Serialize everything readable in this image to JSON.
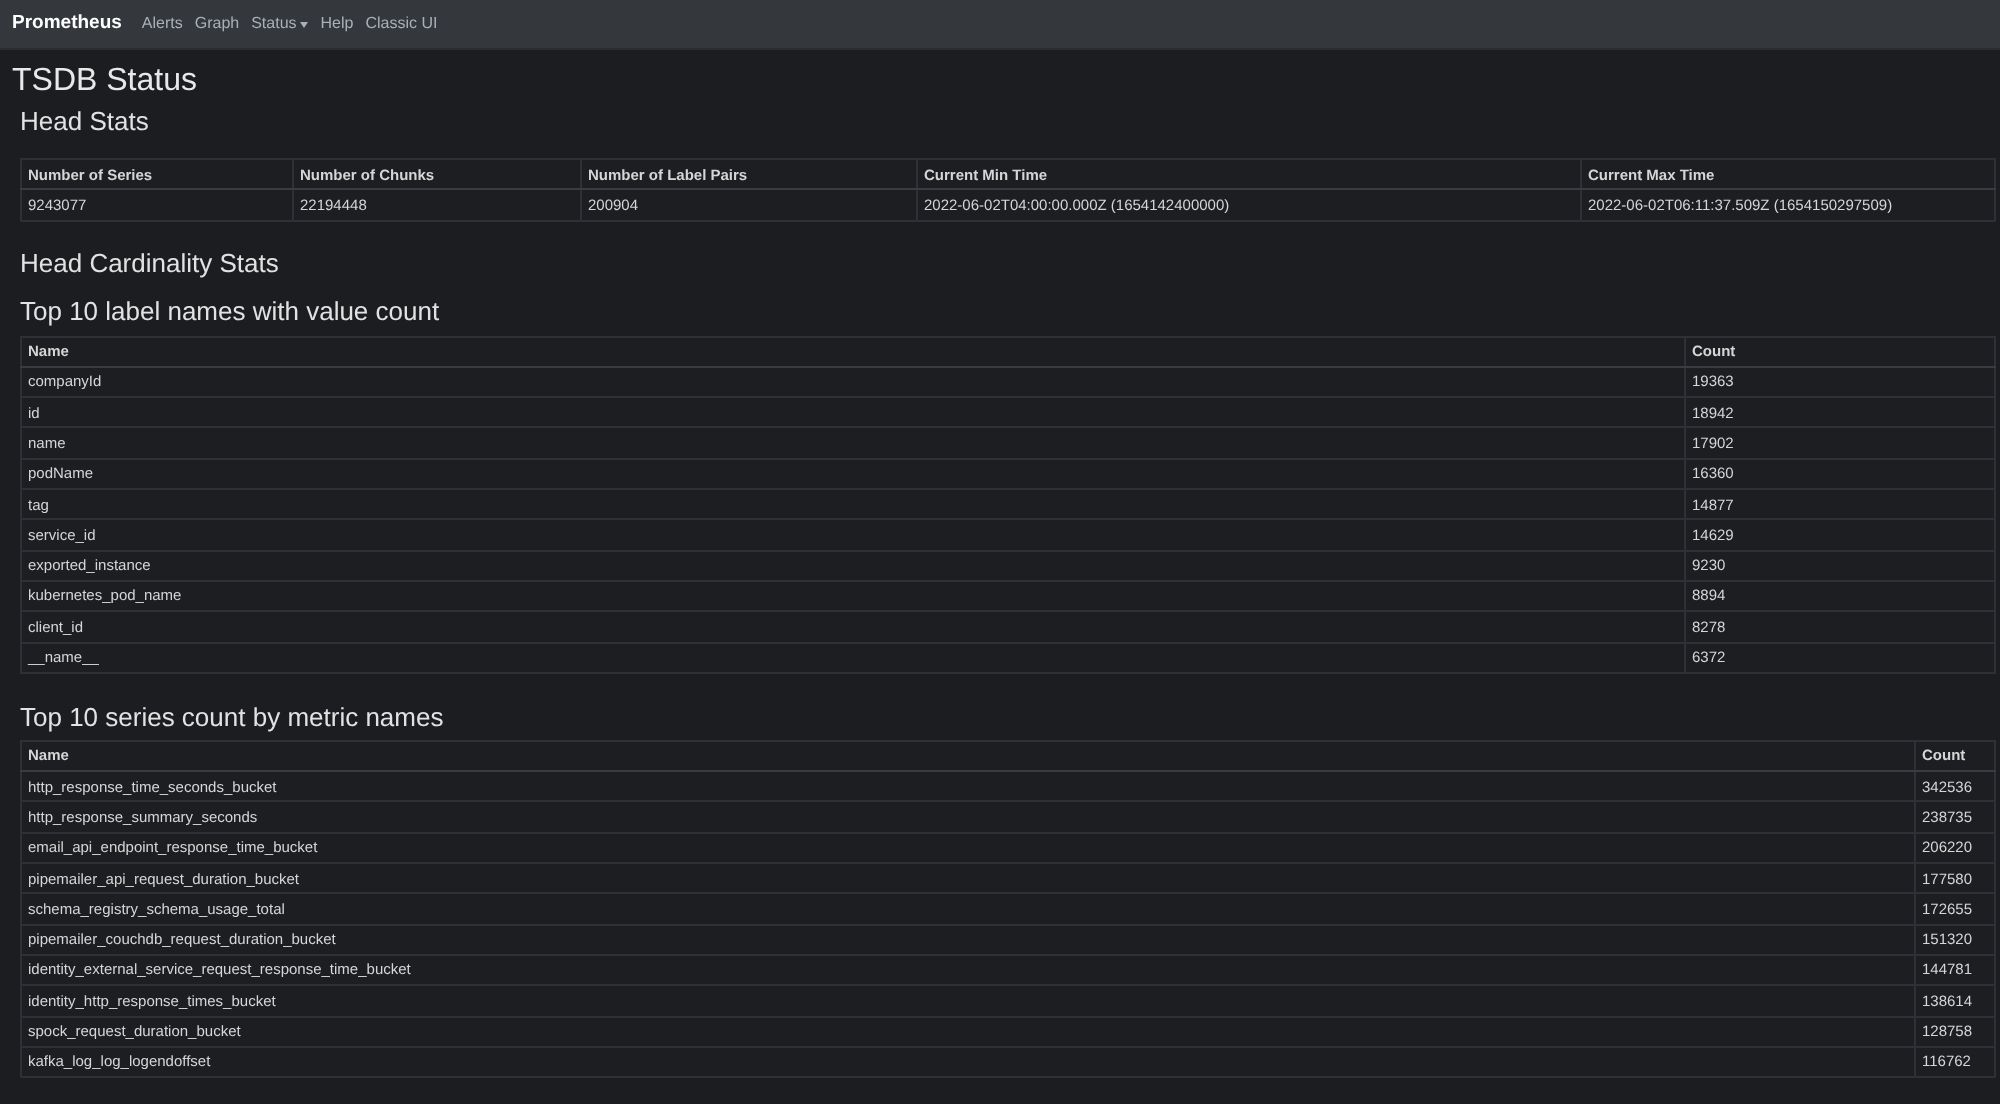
{
  "navbar": {
    "brand": "Prometheus",
    "links": [
      {
        "label": "Alerts",
        "dropdown": false
      },
      {
        "label": "Graph",
        "dropdown": false
      },
      {
        "label": "Status",
        "dropdown": true
      },
      {
        "label": "Help",
        "dropdown": false
      },
      {
        "label": "Classic UI",
        "dropdown": false
      }
    ]
  },
  "title": "TSDB Status",
  "head_stats": {
    "heading": "Head Stats",
    "columns": [
      "Number of Series",
      "Number of Chunks",
      "Number of Label Pairs",
      "Current Min Time",
      "Current Max Time"
    ],
    "rows": [
      [
        "9243077",
        "22194448",
        "200904",
        "2022-06-02T04:00:00.000Z (1654142400000)",
        "2022-06-02T06:11:37.509Z (1654150297509)"
      ]
    ]
  },
  "cardinality_heading": "Head Cardinality Stats",
  "label_names": {
    "heading": "Top 10 label names with value count",
    "columns": [
      "Name",
      "Count"
    ],
    "rows": [
      [
        "companyId",
        "19363"
      ],
      [
        "id",
        "18942"
      ],
      [
        "name",
        "17902"
      ],
      [
        "podName",
        "16360"
      ],
      [
        "tag",
        "14877"
      ],
      [
        "service_id",
        "14629"
      ],
      [
        "exported_instance",
        "9230"
      ],
      [
        "kubernetes_pod_name",
        "8894"
      ],
      [
        "client_id",
        "8278"
      ],
      [
        "__name__",
        "6372"
      ]
    ]
  },
  "metric_names": {
    "heading": "Top 10 series count by metric names",
    "columns": [
      "Name",
      "Count"
    ],
    "rows": [
      [
        "http_response_time_seconds_bucket",
        "342536"
      ],
      [
        "http_response_summary_seconds",
        "238735"
      ],
      [
        "email_api_endpoint_response_time_bucket",
        "206220"
      ],
      [
        "pipemailer_api_request_duration_bucket",
        "177580"
      ],
      [
        "schema_registry_schema_usage_total",
        "172655"
      ],
      [
        "pipemailer_couchdb_request_duration_bucket",
        "151320"
      ],
      [
        "identity_external_service_request_response_time_bucket",
        "144781"
      ],
      [
        "identity_http_response_times_bucket",
        "138614"
      ],
      [
        "spock_request_duration_bucket",
        "128758"
      ],
      [
        "kafka_log_log_logendoffset",
        "116762"
      ]
    ]
  }
}
